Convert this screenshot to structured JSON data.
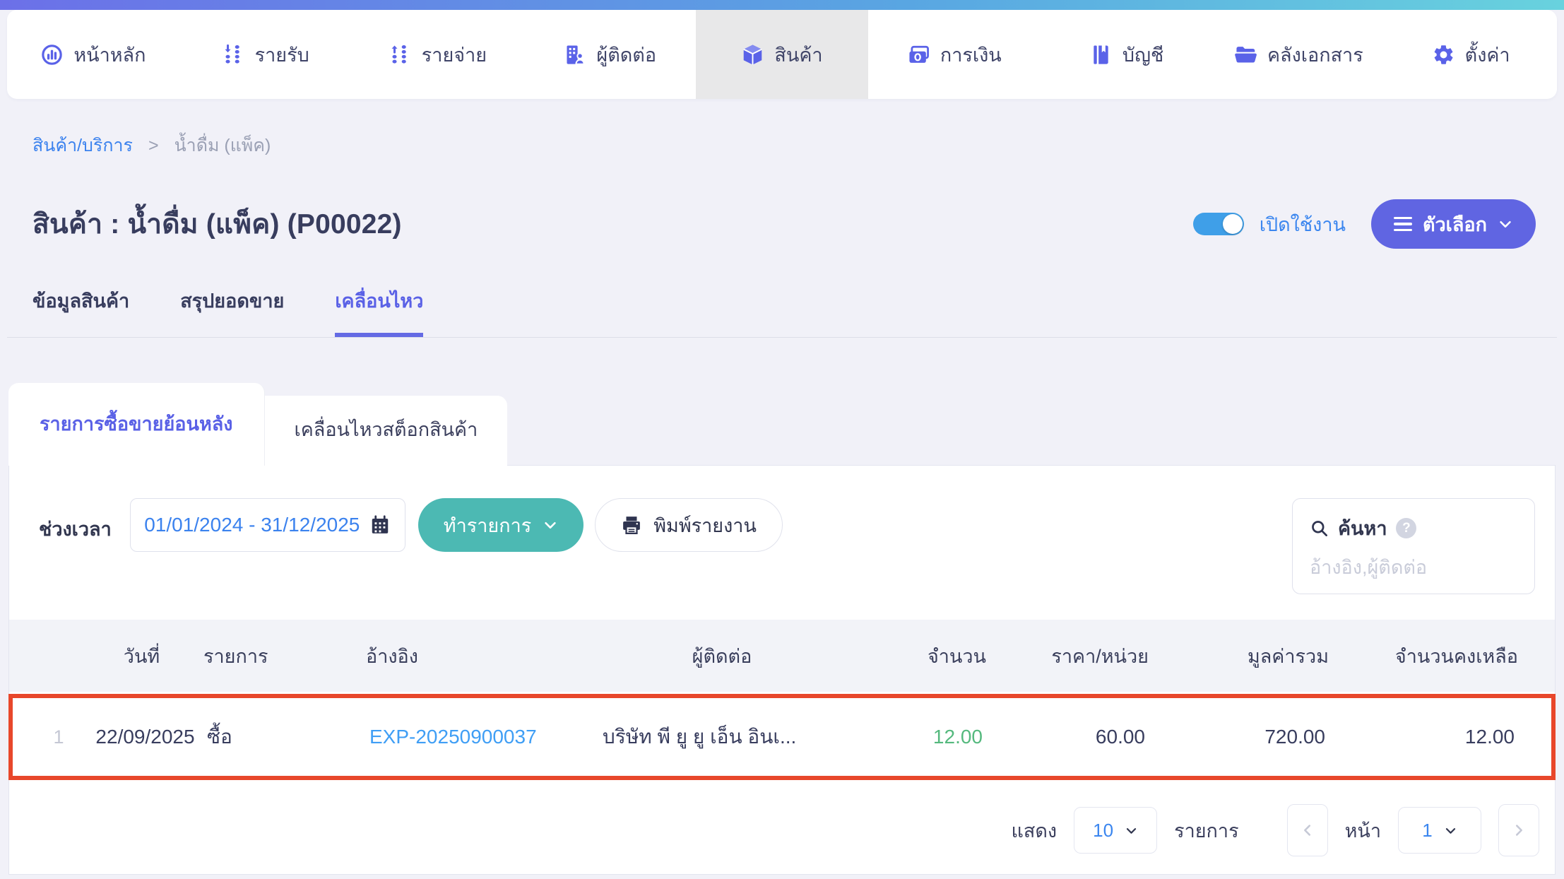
{
  "colors": {
    "accent_purple": "#6065e2",
    "accent_teal": "#4cb9b3",
    "link_blue": "#3b82ee",
    "reference_blue": "#3f9ef5",
    "success_green": "#55b97e",
    "highlight_red": "#e8472b",
    "toggle_blue": "#3f9fe8",
    "header_gradient": [
      "#6c70e8",
      "#68d2de"
    ]
  },
  "nav": {
    "items": [
      {
        "label": "หน้าหลัก",
        "icon": "dashboard-icon",
        "active": false
      },
      {
        "label": "รายรับ",
        "icon": "income-icon",
        "active": false
      },
      {
        "label": "รายจ่าย",
        "icon": "expense-icon",
        "active": false
      },
      {
        "label": "ผู้ติดต่อ",
        "icon": "contacts-icon",
        "active": false
      },
      {
        "label": "สินค้า",
        "icon": "products-icon",
        "active": true
      },
      {
        "label": "การเงิน",
        "icon": "finance-icon",
        "active": false
      },
      {
        "label": "บัญชี",
        "icon": "accounting-icon",
        "active": false
      },
      {
        "label": "คลังเอกสาร",
        "icon": "documents-icon",
        "active": false
      },
      {
        "label": "ตั้งค่า",
        "icon": "settings-icon",
        "active": false
      }
    ]
  },
  "breadcrumb": {
    "parent": "สินค้า/บริการ",
    "separator": ">",
    "current": "น้ำดื่ม (แพ็ค)"
  },
  "header": {
    "title": "สินค้า : น้ำดื่ม (แพ็ค) (P00022)",
    "toggle_label": "เปิดใช้งาน",
    "toggle_state": "on",
    "options_button": "ตัวเลือก"
  },
  "tabs": [
    {
      "label": "ข้อมูลสินค้า",
      "active": false
    },
    {
      "label": "สรุปยอดขาย",
      "active": false
    },
    {
      "label": "เคลื่อนไหว",
      "active": true
    }
  ],
  "subtabs": [
    {
      "label": "รายการซื้อขายย้อนหลัง",
      "active": true
    },
    {
      "label": "เคลื่อนไหวสต็อกสินค้า",
      "active": false
    }
  ],
  "filters": {
    "period_label": "ช่วงเวลา",
    "date_range": "01/01/2024 - 31/12/2025",
    "action_button": "ทำรายการ",
    "print_button": "พิมพ์รายงาน",
    "search_label": "ค้นหา",
    "help_glyph": "?",
    "search_placeholder": "อ้างอิง,ผู้ติดต่อ"
  },
  "table": {
    "headers": [
      "วันที่",
      "รายการ",
      "อ้างอิง",
      "ผู้ติดต่อ",
      "จำนวน",
      "ราคา/หน่วย",
      "มูลค่ารวม",
      "จำนวนคงเหลือ"
    ],
    "rows": [
      {
        "index": "1",
        "date": "22/09/2025",
        "type": "ซื้อ",
        "reference": "EXP-20250900037",
        "contact": "บริษัท พี ยู ยู เอ็น อินเ...",
        "quantity": "12.00",
        "unit_price": "60.00",
        "total": "720.00",
        "remaining": "12.00",
        "highlighted": true
      }
    ]
  },
  "pagination": {
    "show_label": "แสดง",
    "per_page": "10",
    "items_label": "รายการ",
    "page_label": "หน้า",
    "page": "1"
  }
}
